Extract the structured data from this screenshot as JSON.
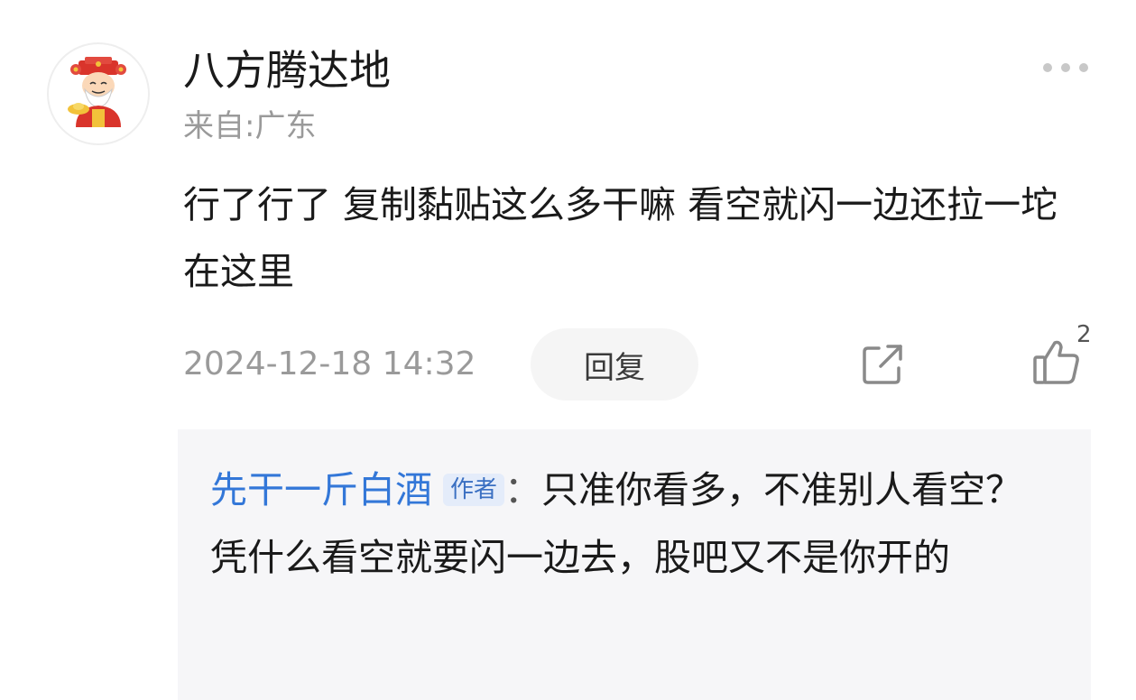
{
  "comment": {
    "username": "八方腾达地",
    "location": "来自:广东",
    "text": "行了行了 复制黏贴这么多干嘛 看空就闪一边还拉一坨在这里",
    "timestamp": "2024-12-18 14:32",
    "reply_label": "回复",
    "like_count": "2",
    "avatar_icon": "cartoon-fortune-god-avatar",
    "icons": [
      "more-dots-icon",
      "share-icon",
      "thumbs-up-icon"
    ]
  },
  "reply": {
    "author": "先干一斤白酒",
    "badge": "作者",
    "separator": "：",
    "text": "只准你看多，不准别人看空？凭什么看空就要闪一边去，股吧又不是你开的"
  },
  "colors": {
    "author_link": "#3377d8",
    "badge_bg": "#e4ecfa",
    "muted_text": "#9a9a9a",
    "reply_bg": "#f6f6f8"
  }
}
